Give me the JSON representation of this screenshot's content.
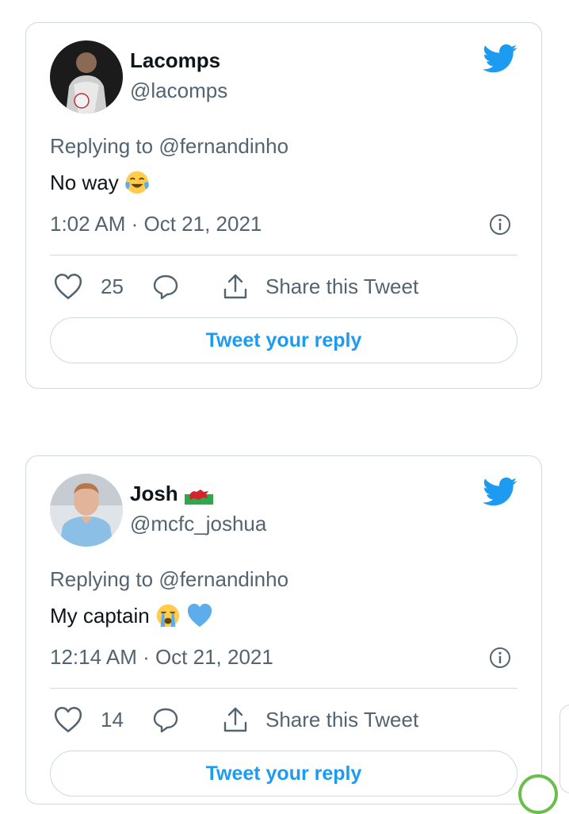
{
  "tweets": [
    {
      "display_name": "Lacomps",
      "handle": "@lacomps",
      "replying_prefix": "Replying to",
      "replying_to": "@fernandinho",
      "text": "No way",
      "emojis": [
        "face-with-tears-of-joy"
      ],
      "timestamp": "1:02 AM · Oct 21, 2021",
      "like_count": "25",
      "share_label": "Share this Tweet",
      "reply_button": "Tweet your reply"
    },
    {
      "display_name": "Josh",
      "name_flag": "wales-flag",
      "handle": "@mcfc_joshua",
      "replying_prefix": "Replying to",
      "replying_to": "@fernandinho",
      "text": "My captain",
      "emojis": [
        "loudly-crying-face",
        "blue-heart"
      ],
      "timestamp": "12:14 AM · Oct 21, 2021",
      "like_count": "14",
      "share_label": "Share this Tweet",
      "reply_button": "Tweet your reply"
    }
  ],
  "colors": {
    "accent": "#1d9bf0",
    "text": "#0f1419",
    "secondary_text": "#536471",
    "border": "#cfd9de"
  }
}
